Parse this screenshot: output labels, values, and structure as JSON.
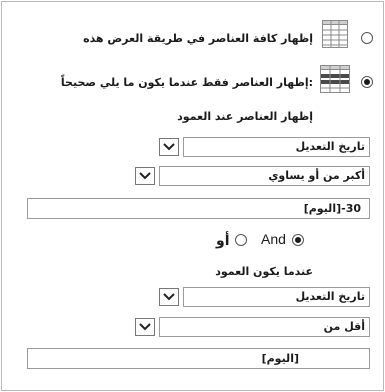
{
  "options": {
    "show_all_label": "إظهار كافة العناصر في طريقة العرض هذه",
    "show_filtered_label": "إظهار العناصر فقط عندما يكون ما يلي صحيحاً:",
    "selected": "show_filtered"
  },
  "filter1": {
    "heading": "إظهار العناصر عند العمود",
    "column_value": "تاريخ التعديل",
    "operator_value": "أكبر من أو يساوي",
    "value_text": "[اليوم]-30"
  },
  "logic": {
    "and_label": "And",
    "or_label": "أو",
    "selected": "and"
  },
  "filter2": {
    "heading": "عندما يكون العمود",
    "column_value": "تاريخ التعديل",
    "operator_value": "أقل من",
    "value_text": "[اليوم]"
  }
}
